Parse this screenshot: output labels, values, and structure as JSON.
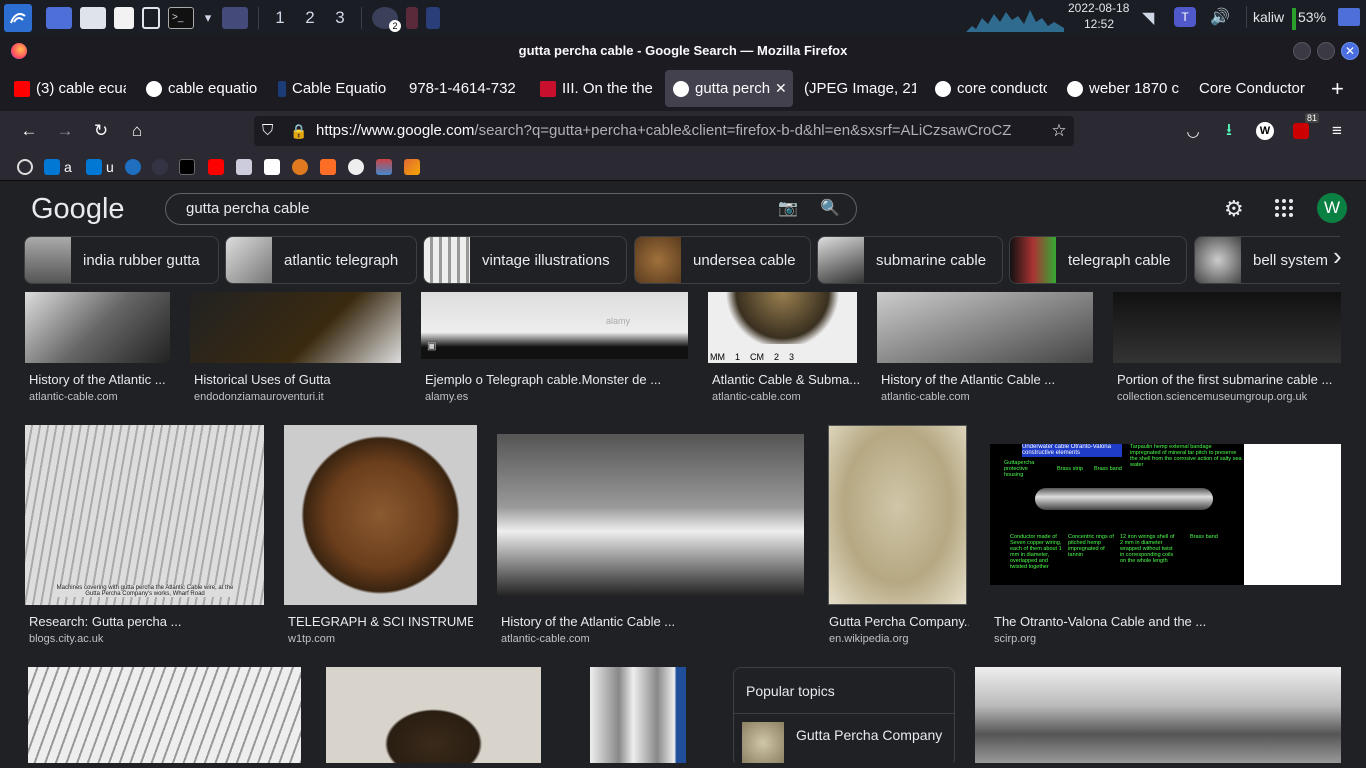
{
  "taskbar": {
    "workspaces": [
      "1",
      "2",
      "3"
    ],
    "badge": "2",
    "date": "2022-08-18",
    "time": "12:52",
    "user": "kaliw",
    "battery": "53%"
  },
  "window": {
    "title": "gutta percha cable - Google Search — Mozilla Firefox"
  },
  "tabs": [
    {
      "label": "(3) cable ecua",
      "favicon": "youtube-icon"
    },
    {
      "label": "cable equatio",
      "favicon": "google-icon"
    },
    {
      "label": "Cable Equatio",
      "favicon": "doc-icon"
    },
    {
      "label": "978-1-4614-732",
      "favicon": "none"
    },
    {
      "label": "III. On the the",
      "favicon": "red-square-icon"
    },
    {
      "label": "gutta perch",
      "favicon": "google-icon",
      "active": true
    },
    {
      "label": "(JPEG Image, 218",
      "favicon": "none"
    },
    {
      "label": "core conducto",
      "favicon": "google-icon"
    },
    {
      "label": "weber 1870 c",
      "favicon": "google-icon"
    },
    {
      "label": "Core Conductor T",
      "favicon": "none"
    }
  ],
  "nav": {
    "url_host": "https://www.google.com",
    "url_path": "/search?q=gutta+percha+cable&client=firefox-b-d&hl=en&sxsrf=ALiCzsawCroCZ",
    "badge_count": "81"
  },
  "bookmarks": [
    {
      "label": "a",
      "icon": "outlook-icon"
    },
    {
      "label": "u",
      "icon": "outlook-icon"
    }
  ],
  "google": {
    "logo": "Google",
    "query": "gutta percha cable",
    "avatar": "W",
    "chips": [
      "india rubber gutta",
      "atlantic telegraph",
      "vintage illustrations",
      "undersea cable",
      "submarine cable",
      "telegraph cable",
      "bell system"
    ]
  },
  "results_row1": [
    {
      "caption": "History of the Atlantic ...",
      "source": "atlantic-cable.com"
    },
    {
      "caption": "Historical Uses of Gutta",
      "source": "endodonziamauroventuri.it"
    },
    {
      "caption": "Ejemplo o Telegraph cable.Monster de ...",
      "source": "alamy.es"
    },
    {
      "caption": "Atlantic Cable & Subma...",
      "source": "atlantic-cable.com"
    },
    {
      "caption": "History of the Atlantic Cable ...",
      "source": "atlantic-cable.com"
    },
    {
      "caption": "Portion of the first submarine cable ...",
      "source": "collection.sciencemuseumgroup.org.uk"
    }
  ],
  "results_row2": [
    {
      "caption": "Research: Gutta percha ...",
      "source": "blogs.city.ac.uk",
      "image_text": "Machines covering with gutta percha the Atlantic Cable wire, at the Gutta Percha Company's works, Wharf Road"
    },
    {
      "caption": "TELEGRAPH & SCI INSTRUMEN...",
      "source": "w1tp.com"
    },
    {
      "caption": "History of the Atlantic Cable ...",
      "source": "atlantic-cable.com"
    },
    {
      "caption": "Gutta Percha Company...",
      "source": "en.wikipedia.org"
    },
    {
      "caption": "The Otranto-Valona Cable and the ...",
      "source": "scirp.org"
    }
  ],
  "cable_diagram": {
    "title": "Underwater cable Otranto-Valona constructive elements",
    "labels": [
      "Tarpaulin hemp external bandage impregnated of mineral tar pitch to preserve the shell from the corrosive action of salty sea water",
      "Guttapercha protective housing",
      "Brass strip",
      "Brass band",
      "Conductor made of Seven copper wiring, each of them about 1 mm in diameter, overlapped and twisted together",
      "Concentric rings of pitched hemp impregnated of tannin",
      "12 iron wirings shell of 2 mm in diameter wrapped without twist in corresponding coils on the whole length",
      "Brass band"
    ]
  },
  "ruler_labels": [
    "MM",
    "1",
    "CM",
    "2",
    "3"
  ],
  "watermark": "alamy",
  "popular_topics": {
    "title": "Popular topics",
    "item": "Gutta Percha Company"
  },
  "colors": {
    "taskbar_bg": "#1a1d24",
    "accent_blue": "#8ab4f8",
    "avatar_bg": "#0b8043",
    "diagram_bg": "#000000",
    "diagram_title_bg": "#1e3cc8",
    "diagram_text": "#4cff4c"
  }
}
